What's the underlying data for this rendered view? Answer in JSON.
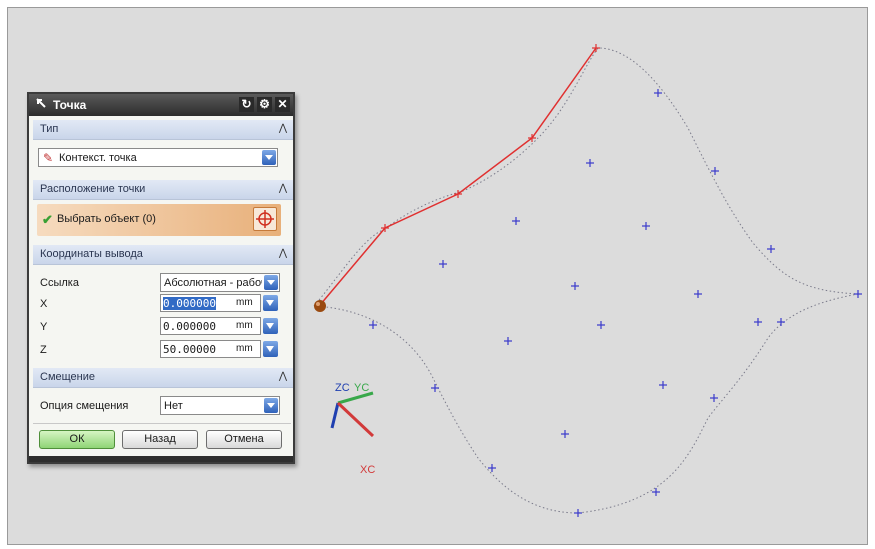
{
  "dialog": {
    "title": "Точка",
    "sections": {
      "type": {
        "label": "Тип",
        "value": "Контекст. точка"
      },
      "location": {
        "label": "Расположение точки",
        "select_label": "Выбрать объект (0)"
      },
      "output": {
        "label": "Координаты вывода",
        "reference_label": "Ссылка",
        "reference_value": "Абсолютная - рабоч",
        "x_label": "X",
        "x_value": "0.000000",
        "x_value_rest": ".000000",
        "y_label": "Y",
        "y_value": "0.000000",
        "z_label": "Z",
        "z_value": "50.00000",
        "unit": "mm"
      },
      "offset": {
        "label": "Смещение",
        "option_label": "Опция смещения",
        "option_value": "Нет"
      }
    },
    "buttons": {
      "ok": "ОК",
      "back": "Назад",
      "cancel": "Отмена"
    }
  },
  "axes": {
    "zc": "ZC",
    "yc": "YC",
    "xc": "XC"
  },
  "colors": {
    "polyline": "#e03030",
    "points": "#3a3acc",
    "curve": "#7a7a8a",
    "zc": "#1f3fb0",
    "yc": "#38a84a",
    "xc": "#d23a3a",
    "origin_ball": "#9a4a10"
  }
}
